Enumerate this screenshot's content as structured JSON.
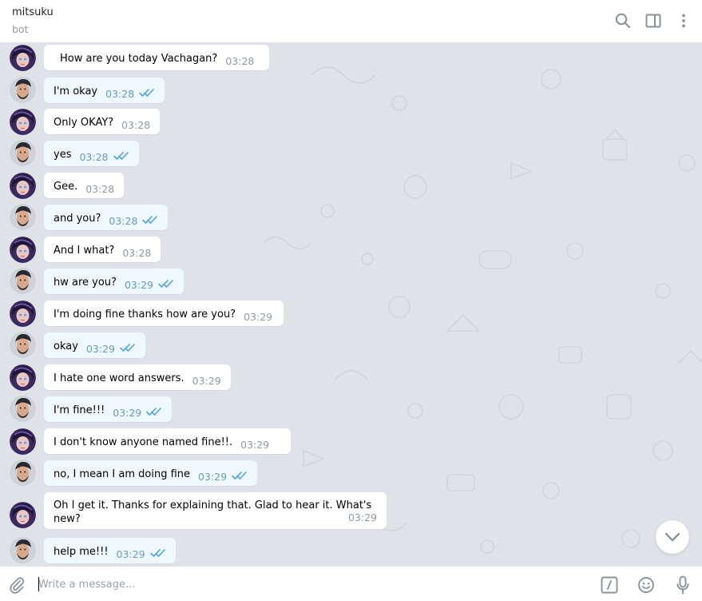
{
  "header": {
    "chat_name": "mitsuku",
    "chat_status": "bot",
    "icons": [
      "search-icon",
      "sidebar-toggle-icon",
      "more-vertical-icon"
    ]
  },
  "messages": [
    {
      "sender": "bot",
      "text": "How are you today  Vachagan?",
      "time": "03:28",
      "read": false
    },
    {
      "sender": "user",
      "text": "I'm okay",
      "time": "03:28",
      "read": true
    },
    {
      "sender": "bot",
      "text": "Only OKAY?",
      "time": "03:28",
      "read": false
    },
    {
      "sender": "user",
      "text": "yes",
      "time": "03:28",
      "read": true
    },
    {
      "sender": "bot",
      "text": "Gee.",
      "time": "03:28",
      "read": false
    },
    {
      "sender": "user",
      "text": "and you?",
      "time": "03:28",
      "read": true
    },
    {
      "sender": "bot",
      "text": "And I what?",
      "time": "03:28",
      "read": false
    },
    {
      "sender": "user",
      "text": "hw are you?",
      "time": "03:29",
      "read": true
    },
    {
      "sender": "bot",
      "text": "I'm doing fine thanks how are you?",
      "time": "03:29",
      "read": false
    },
    {
      "sender": "user",
      "text": "okay",
      "time": "03:29",
      "read": true
    },
    {
      "sender": "bot",
      "text": "I hate one word answers.",
      "time": "03:29",
      "read": false
    },
    {
      "sender": "user",
      "text": "I'm fine!!!",
      "time": "03:29",
      "read": true
    },
    {
      "sender": "bot",
      "text": "I don't know anyone named   fine!!.",
      "time": "03:29",
      "read": false
    },
    {
      "sender": "user",
      "text": "no, I mean I am doing fine",
      "time": "03:29",
      "read": true
    },
    {
      "sender": "bot",
      "text": "Oh I get it. Thanks for explaining that. Glad to hear it. What's new?",
      "time": "03:29",
      "read": false
    },
    {
      "sender": "user",
      "text": "help me!!!",
      "time": "03:29",
      "read": true
    }
  ],
  "composer": {
    "placeholder": "Write a message...",
    "value": "",
    "icons": [
      "attach-icon",
      "bot-command-icon",
      "emoji-icon",
      "microphone-icon"
    ]
  },
  "colors": {
    "chat_background": "#dfe3e8",
    "incoming_bubble": "#ffffff",
    "outgoing_bubble": "#eef8fe",
    "read_check": "#4fa3e0",
    "timestamp": "#8d9aa6"
  }
}
